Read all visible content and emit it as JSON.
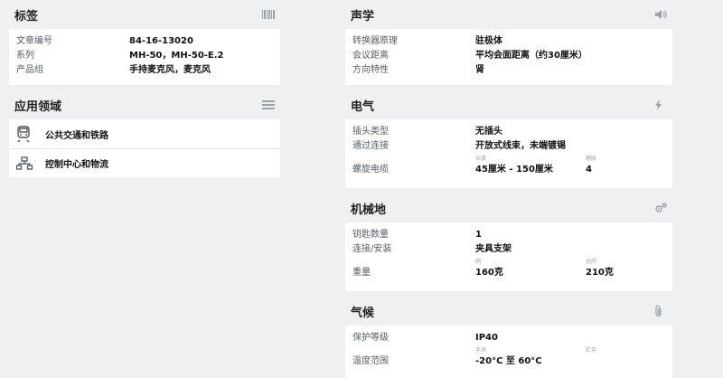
{
  "tags": {
    "title": "标签",
    "icon": "barcode-icon",
    "rows": [
      {
        "label": "文章编号",
        "value": "84-16-13020"
      },
      {
        "label": "系列",
        "value": "MH-50，MH-50-E.2"
      },
      {
        "label": "产品组",
        "value": "手持麦克风，麦克风"
      }
    ]
  },
  "applications": {
    "title": "应用领域",
    "icon": "list-icon",
    "items": [
      {
        "label": "公共交通和铁路",
        "icon": "train-icon"
      },
      {
        "label": "控制中心和物流",
        "icon": "network-icon"
      }
    ]
  },
  "acoustics": {
    "title": "声学",
    "icon": "speaker-icon",
    "rows": [
      {
        "label": "转换器原理",
        "value": "驻极体"
      },
      {
        "label": "会议距离",
        "value": "平均会面距离（约30厘米）"
      },
      {
        "label": "方向特性",
        "value": "肾"
      }
    ]
  },
  "electrical": {
    "title": "电气",
    "icon": "lightning-icon",
    "rows": [
      {
        "label": "插头类型",
        "value": "无插头"
      },
      {
        "label": "通过连接",
        "value": "开放式线束，未端镀锡"
      }
    ],
    "sub_labels": [
      "长度",
      "静脉"
    ],
    "cable": {
      "label": "螺旋电缆",
      "value1": "45厘米 - 150厘米",
      "value2": "4"
    }
  },
  "mechanical": {
    "title": "机械地",
    "icon": "gears-icon",
    "rows": [
      {
        "label": "钥匙数量",
        "value": "1"
      },
      {
        "label": "连接/安装",
        "value": "夹具支架"
      }
    ],
    "sub_labels": [
      "网",
      "总的"
    ],
    "weight": {
      "label": "重量",
      "value1": "160克",
      "value2": "210克"
    }
  },
  "climate": {
    "title": "气候",
    "icon": "paperclip-icon",
    "rows": [
      {
        "label": "保护等级",
        "value": "IP40"
      }
    ],
    "sub_labels": [
      "手术",
      "贮存"
    ],
    "temp": {
      "label": "温度范围",
      "value1": "-20°C 至 60°C",
      "value2": ""
    }
  }
}
